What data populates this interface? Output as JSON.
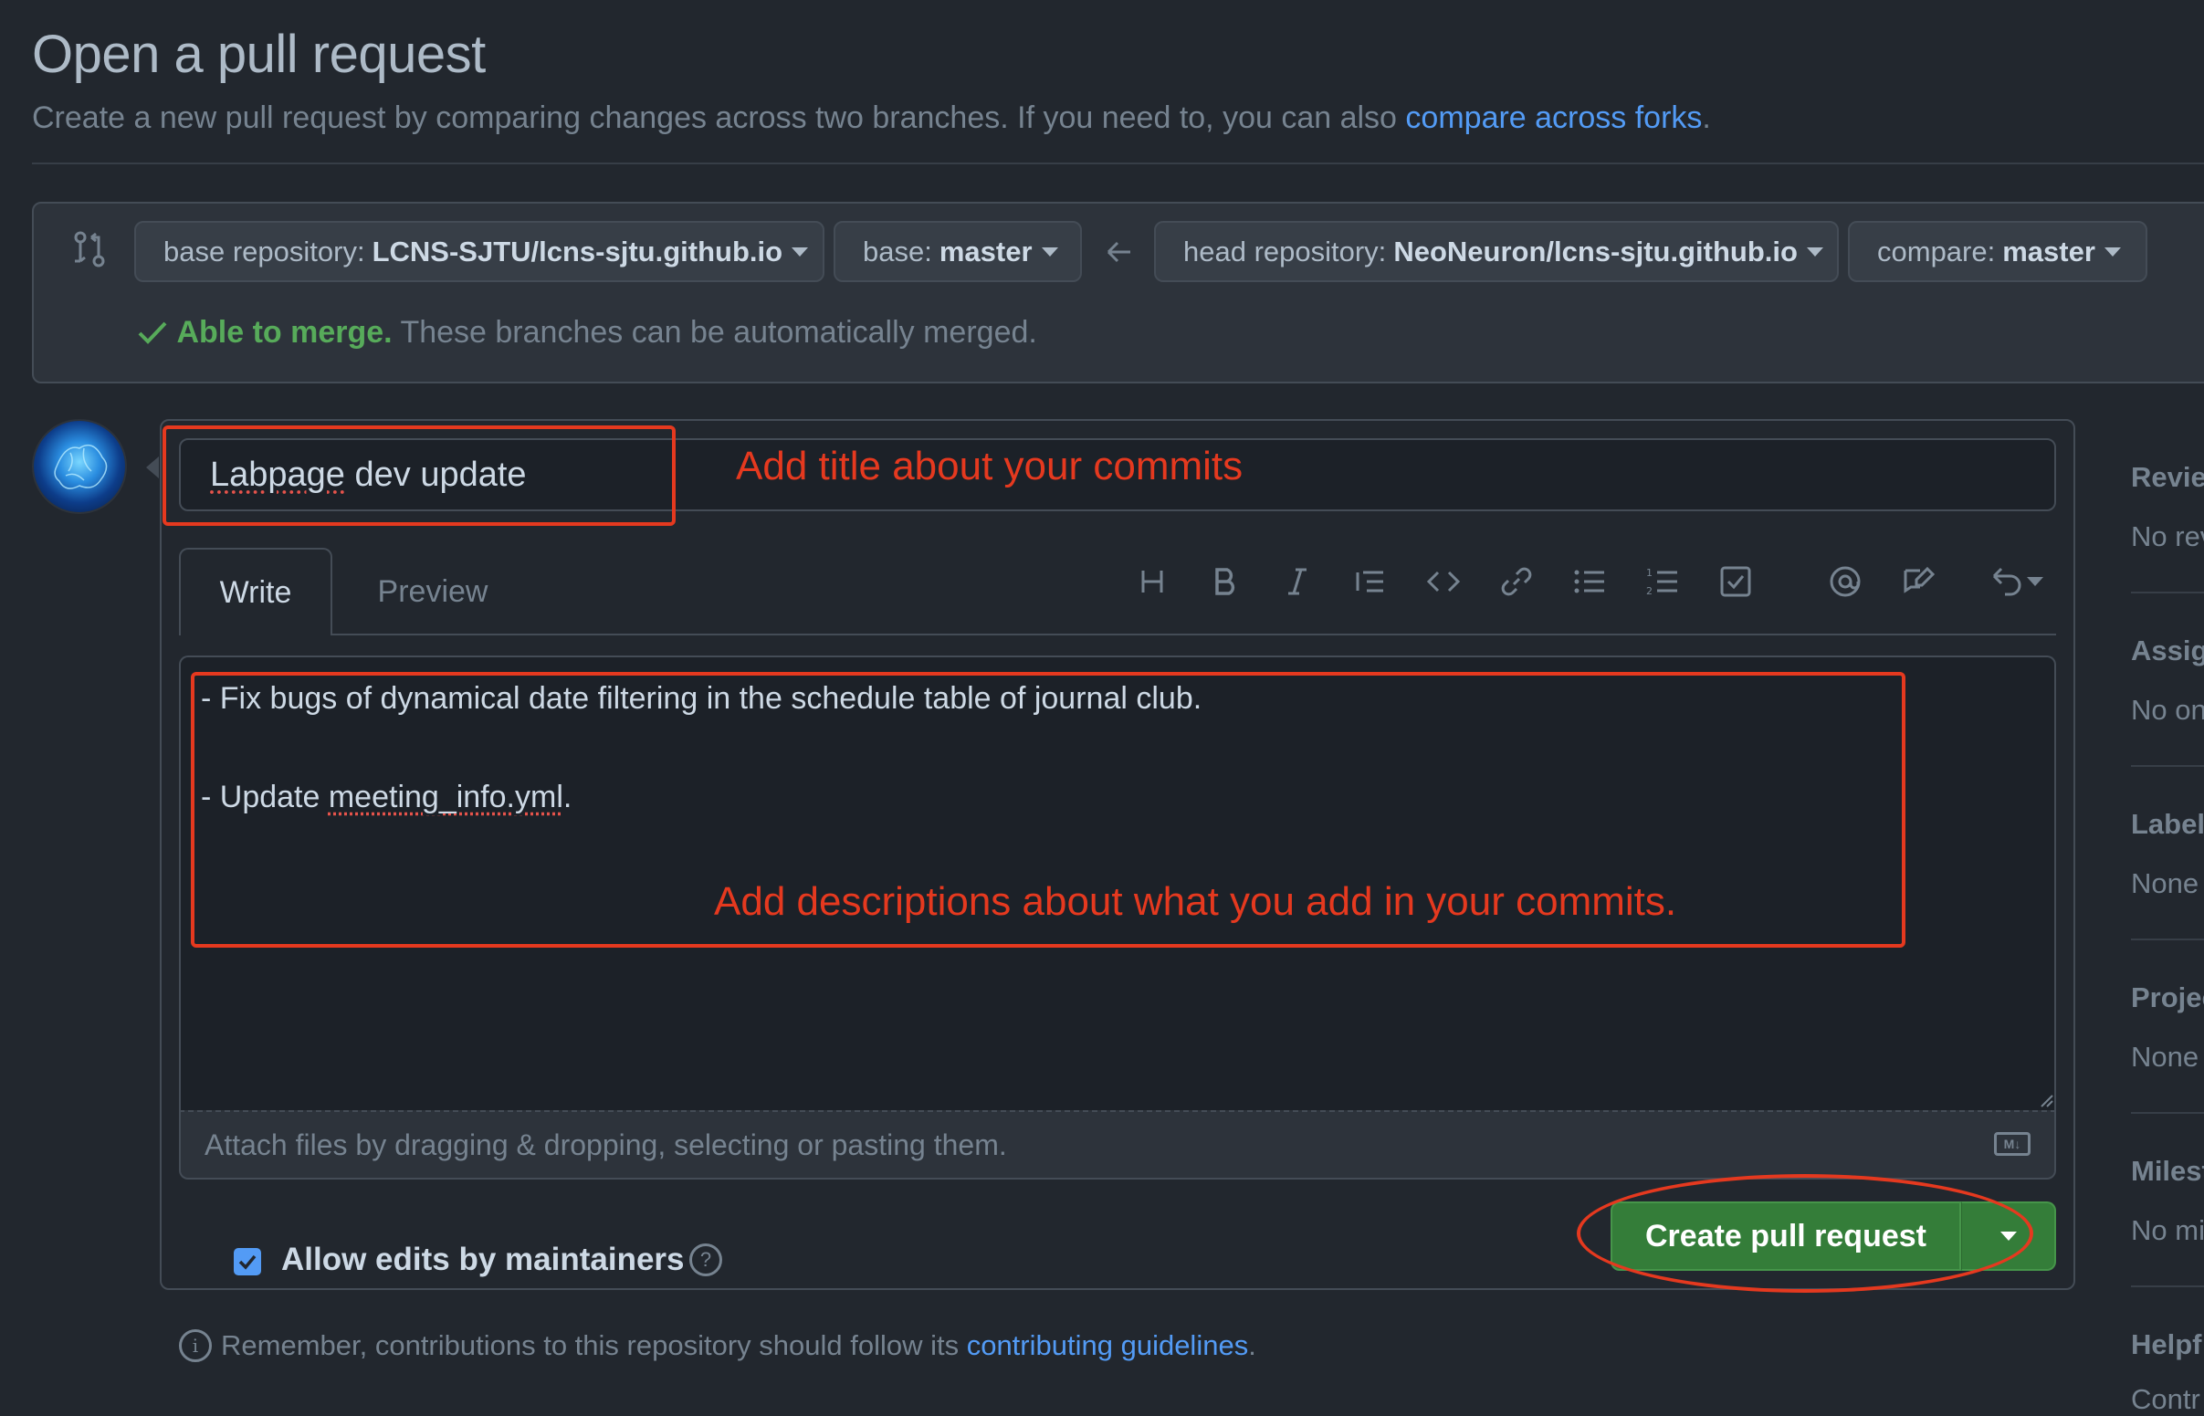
{
  "page": {
    "title": "Open a pull request",
    "subtitle_prefix": "Create a new pull request by comparing changes across two branches. If you need to, you can also ",
    "subtitle_link": "compare across forks",
    "subtitle_suffix": "."
  },
  "compare": {
    "base_repo_label": "base repository:",
    "base_repo_value": "LCNS-SJTU/lcns-sjtu.github.io",
    "base_label": "base:",
    "base_value": "master",
    "head_repo_label": "head repository:",
    "head_repo_value": "NeoNeuron/lcns-sjtu.github.io",
    "compare_label": "compare:",
    "compare_value": "master",
    "merge_status": "Able to merge.",
    "merge_message": " These branches can be automatically merged."
  },
  "form": {
    "title_word1": "Labpage",
    "title_rest": " dev update",
    "tabs": {
      "write": "Write",
      "preview": "Preview"
    },
    "toolbar_icons": [
      "heading-icon",
      "bold-icon",
      "italic-icon",
      "quote-icon",
      "code-icon",
      "link-icon",
      "bulleted-list-icon",
      "numbered-list-icon",
      "task-list-icon",
      "mention-icon",
      "reference-icon",
      "saved-replies-icon"
    ],
    "body_line1": "- Fix bugs of dynamical date filtering in the schedule table of journal club.",
    "body_line2_prefix": "- Update ",
    "body_line2_file": "meeting_info.yml",
    "body_line2_suffix": ".",
    "attach_text": "Attach files by dragging & dropping, selecting or pasting them.",
    "markdown_badge": "M↓",
    "allow_edits": "Allow edits by maintainers",
    "help_glyph": "?",
    "submit": "Create pull request"
  },
  "footer": {
    "prefix": "Remember, contributions to this repository should follow its ",
    "link": "contributing guidelines",
    "suffix": "."
  },
  "sidebar": {
    "reviewers_head": "Revie",
    "reviewers_val": "No rev",
    "assignees_head": "Assig",
    "assignees_val": "No on",
    "labels_head": "Label",
    "labels_val": "None",
    "projects_head": "Projec",
    "projects_val": "None",
    "milestone_head": "Milest",
    "milestone_val": "No mi",
    "helpful_head": "Helpf",
    "helpful_val": "Contr"
  },
  "annotations": {
    "title_note": "Add title about your commits",
    "desc_note": "Add descriptions about what you add in your commits.",
    "color": "#e5391f"
  },
  "colors": {
    "background": "#22272e",
    "accent_link": "#539bf5",
    "success": "#57ab5a",
    "button_green": "#347d39"
  }
}
